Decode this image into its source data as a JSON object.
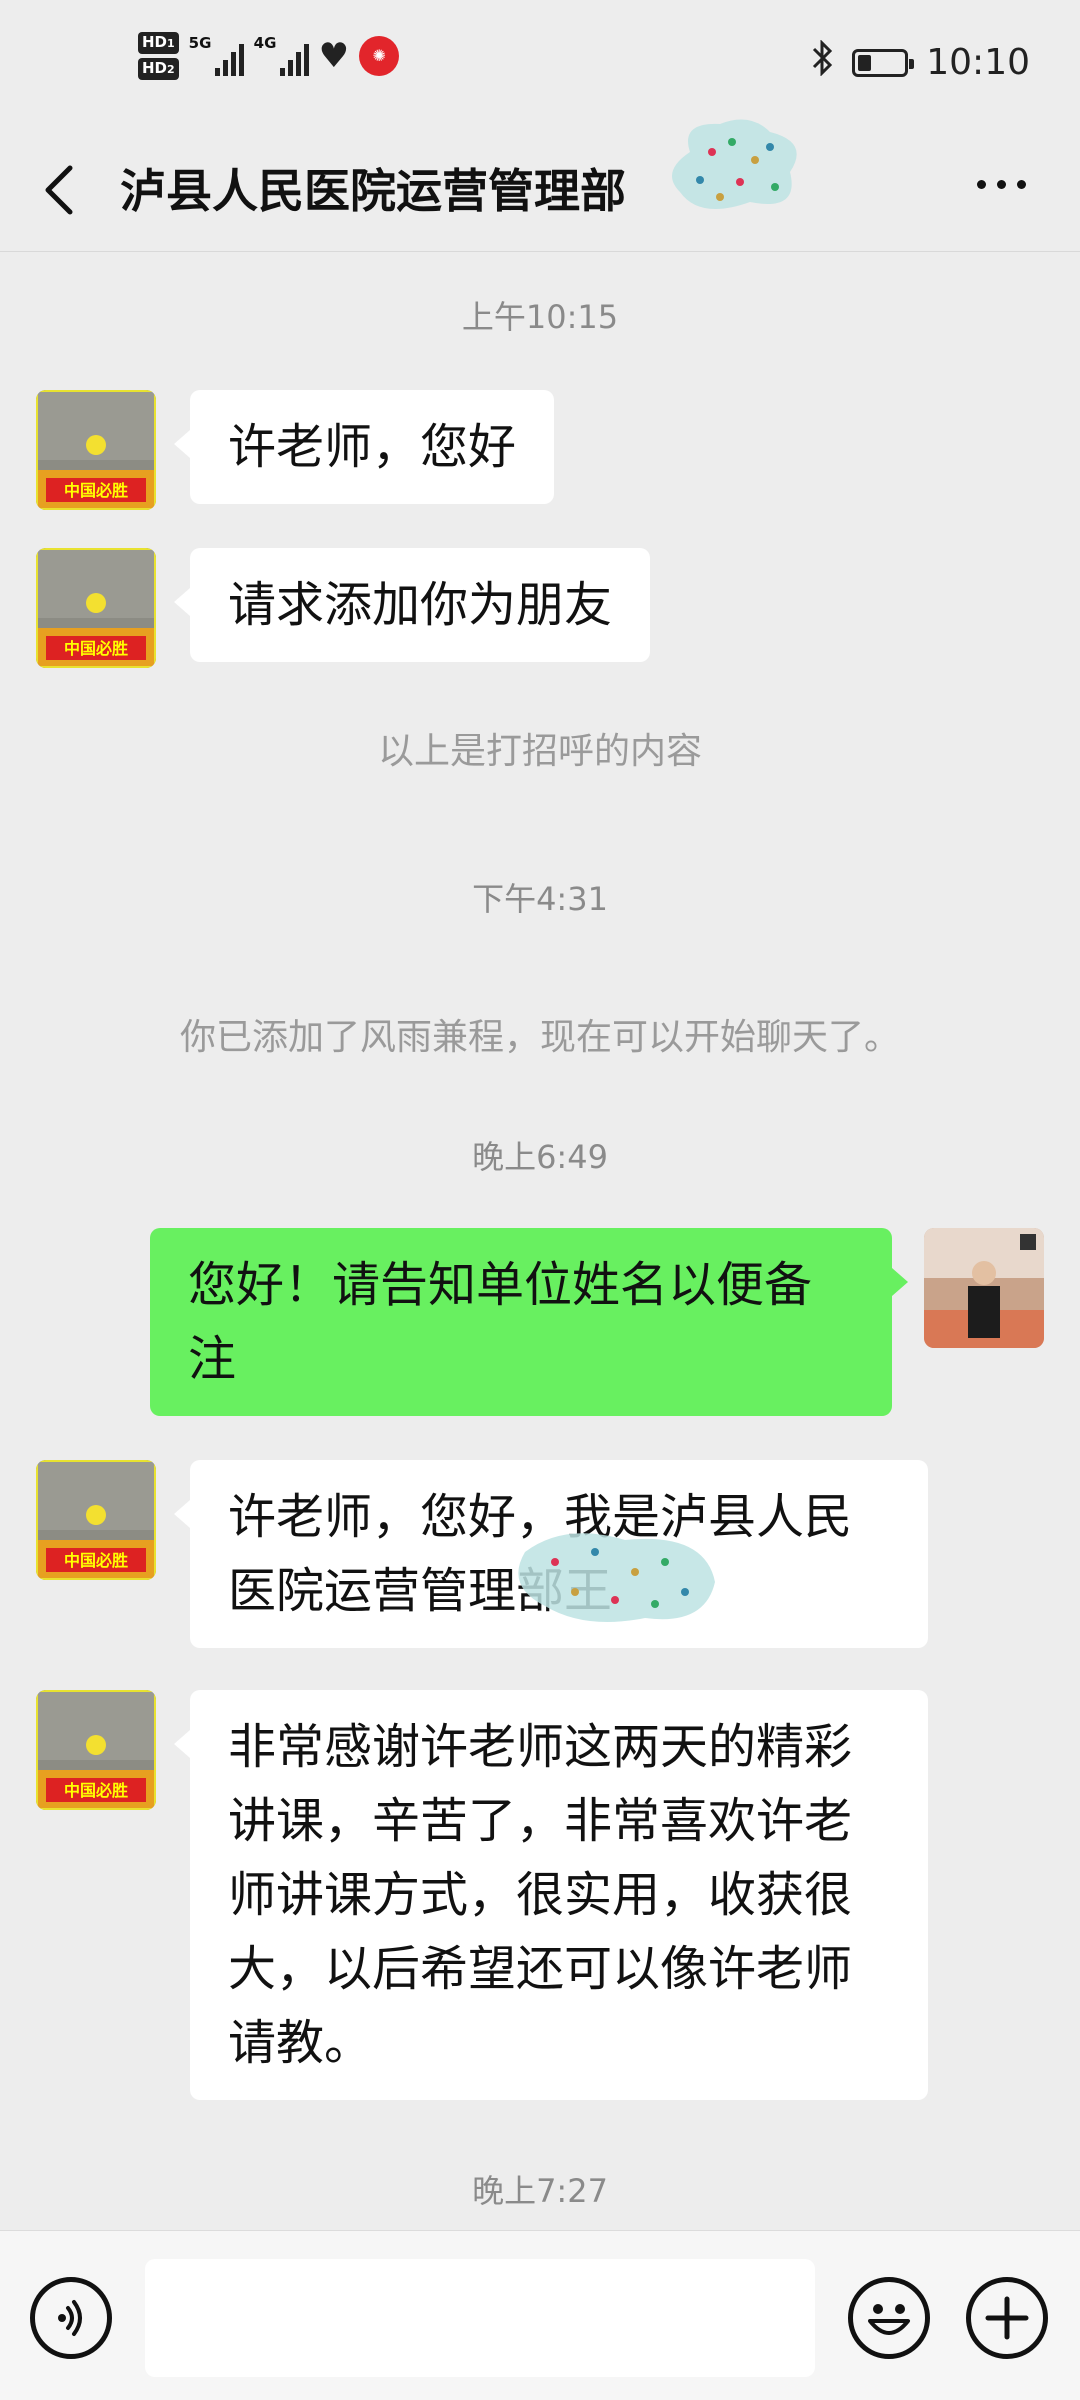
{
  "status_bar": {
    "hd1": "HD",
    "hd1_sub": "1",
    "hd2": "HD",
    "hd2_sub": "2",
    "net1": "5G",
    "net2": "4G",
    "time": "10:10",
    "battery_level": 0.3,
    "icons": [
      "hd-icon",
      "signal-5g-icon",
      "signal-4g-icon",
      "health-heart-icon",
      "app-notification-icon",
      "bluetooth-icon",
      "battery-icon"
    ]
  },
  "header": {
    "title": "泸县人民医院运营管理部"
  },
  "messages": [
    {
      "type": "time",
      "text": "上午10:15"
    },
    {
      "type": "received",
      "text": "许老师，您好"
    },
    {
      "type": "received",
      "text": "请求添加你为朋友"
    },
    {
      "type": "system",
      "text": "以上是打招呼的内容"
    },
    {
      "type": "time",
      "text": "下午4:31"
    },
    {
      "type": "system",
      "text": "你已添加了风雨兼程，现在可以开始聊天了。"
    },
    {
      "type": "time",
      "text": "晚上6:49"
    },
    {
      "type": "sent",
      "text": "您好！请告知单位姓名以便备注"
    },
    {
      "type": "received",
      "text": "许老师，您好，我是泸县人民医院运营管理部王"
    },
    {
      "type": "received",
      "text": "非常感谢许老师这两天的精彩讲课，辛苦了，非常喜欢许老师讲课方式，很实用，收获很大，以后希望还可以像许老师请教。"
    },
    {
      "type": "time",
      "text": "晚上7:27"
    }
  ],
  "colors": {
    "background": "#ededed",
    "sent_bubble": "#68f060",
    "received_bubble": "#ffffff"
  }
}
